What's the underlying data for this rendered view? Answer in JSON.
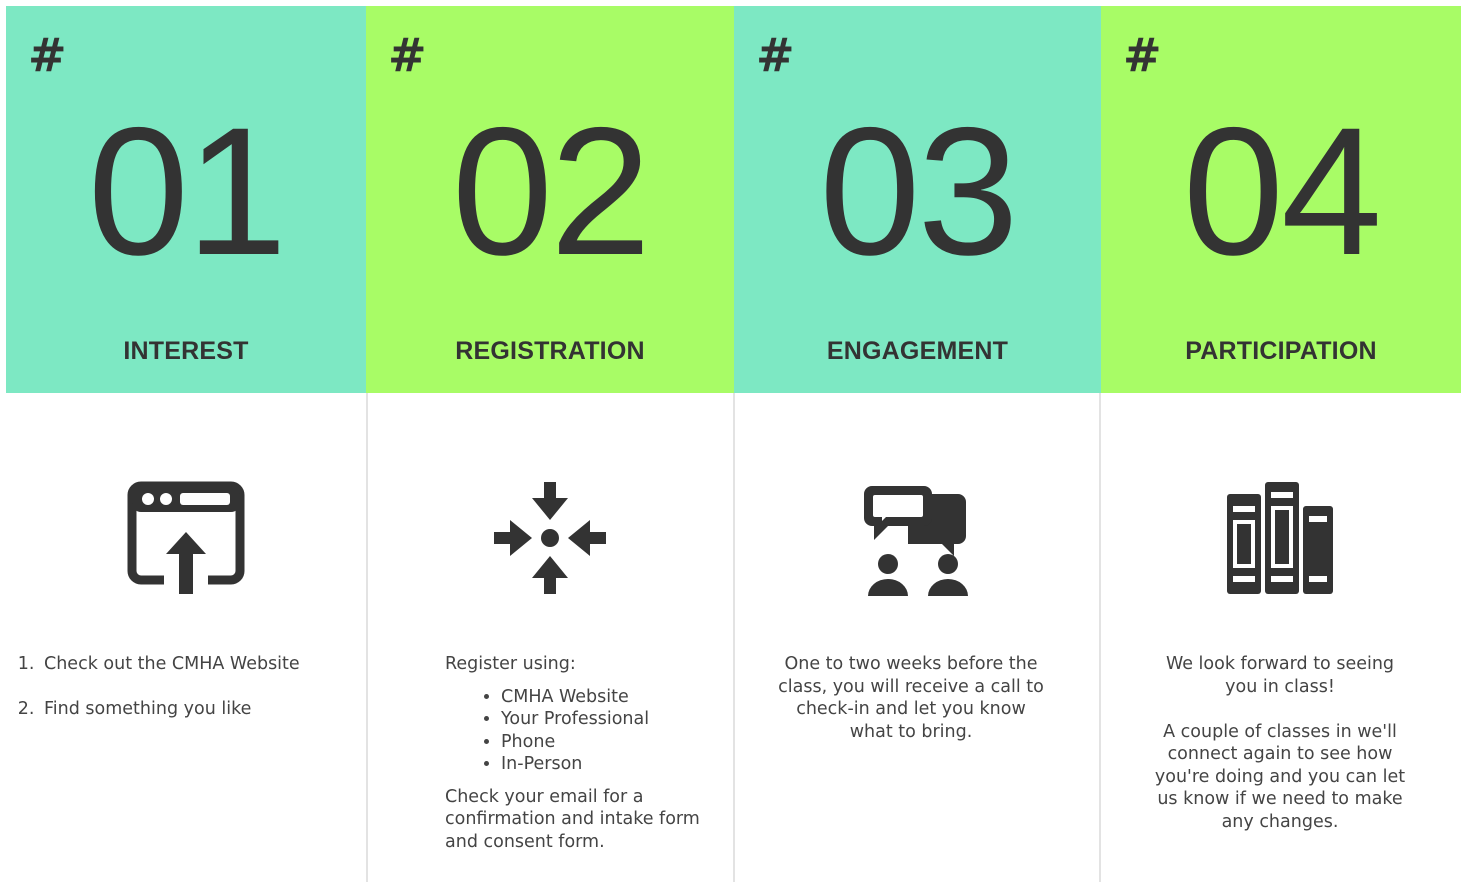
{
  "steps": [
    {
      "hash": "#",
      "number": "01",
      "title": "INTEREST",
      "icon": "browser-upload-icon",
      "items": [
        "Check out the CMHA Website",
        "Find something you like"
      ]
    },
    {
      "hash": "#",
      "number": "02",
      "title": "REGISTRATION",
      "icon": "converge-arrows-icon",
      "intro": "Register using:",
      "options": [
        "CMHA Website",
        "Your Professional",
        "Phone",
        "In-Person"
      ],
      "outro": "Check your email for a confirmation and intake form and consent form."
    },
    {
      "hash": "#",
      "number": "03",
      "title": "ENGAGEMENT",
      "icon": "conversation-people-icon",
      "text": "One to two weeks before the class, you will receive a call to check-in and let you know what to bring."
    },
    {
      "hash": "#",
      "number": "04",
      "title": "PARTICIPATION",
      "icon": "books-icon",
      "text1": "We look forward to seeing you in class!",
      "text2": "A couple of classes in we'll connect again to see how you're doing and you can let us know if we need to make any changes."
    }
  ],
  "colors": {
    "teal": "#7de8c3",
    "green": "#a8fc66",
    "text": "#333333"
  }
}
